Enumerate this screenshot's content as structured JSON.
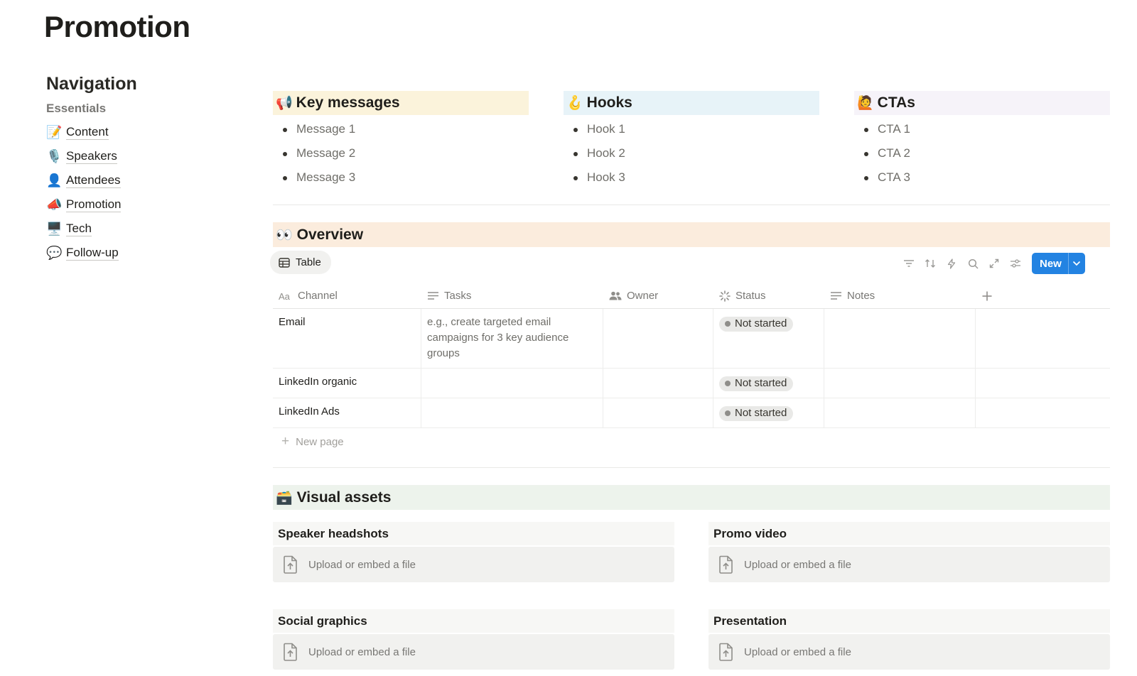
{
  "page": {
    "title": "Promotion"
  },
  "navigation": {
    "heading": "Navigation",
    "subheading": "Essentials",
    "items": [
      {
        "emoji": "📝",
        "label": "Content"
      },
      {
        "emoji": "🎙️",
        "label": "Speakers"
      },
      {
        "emoji": "👤",
        "label": "Attendees"
      },
      {
        "emoji": "📣",
        "label": "Promotion"
      },
      {
        "emoji": "🖥️",
        "label": "Tech"
      },
      {
        "emoji": "💬",
        "label": "Follow-up"
      }
    ]
  },
  "columns": [
    {
      "emoji": "📢",
      "title": "Key messages",
      "bg": "#fbf3db",
      "items": [
        "Message 1",
        "Message 2",
        "Message 3"
      ]
    },
    {
      "emoji": "🪝",
      "title": "Hooks",
      "bg": "#e7f3f8",
      "items": [
        "Hook 1",
        "Hook 2",
        "Hook 3"
      ]
    },
    {
      "emoji": "🙋",
      "title": "CTAs",
      "bg": "#f6f3f9",
      "items": [
        "CTA 1",
        "CTA 2",
        "CTA 3"
      ]
    }
  ],
  "overview": {
    "emoji": "👀",
    "title": "Overview",
    "bg": "#fbecdd",
    "view_label": "Table",
    "new_button": "New",
    "columns": [
      {
        "icon": "text-aa-icon",
        "label": "Channel"
      },
      {
        "icon": "lines-icon",
        "label": "Tasks"
      },
      {
        "icon": "people-icon",
        "label": "Owner"
      },
      {
        "icon": "status-spinner-icon",
        "label": "Status"
      },
      {
        "icon": "lines-icon",
        "label": "Notes"
      }
    ],
    "rows": [
      {
        "channel": "Email",
        "tasks": "e.g., create targeted email campaigns for 3 key audience groups",
        "owner": "",
        "status": "Not started",
        "notes": ""
      },
      {
        "channel": "LinkedIn organic",
        "tasks": "",
        "owner": "",
        "status": "Not started",
        "notes": ""
      },
      {
        "channel": "LinkedIn Ads",
        "tasks": "",
        "owner": "",
        "status": "Not started",
        "notes": ""
      }
    ],
    "new_page_label": "New page"
  },
  "visual_assets": {
    "emoji": "🗃️",
    "title": "Visual assets",
    "bg": "#edf3ec",
    "upload_label": "Upload or embed a file",
    "assets": [
      {
        "title": "Speaker headshots"
      },
      {
        "title": "Promo video"
      },
      {
        "title": "Social graphics"
      },
      {
        "title": "Presentation"
      }
    ]
  },
  "colors": {
    "accent": "#2383e2",
    "text": "#37352f",
    "muted": "#787774"
  }
}
